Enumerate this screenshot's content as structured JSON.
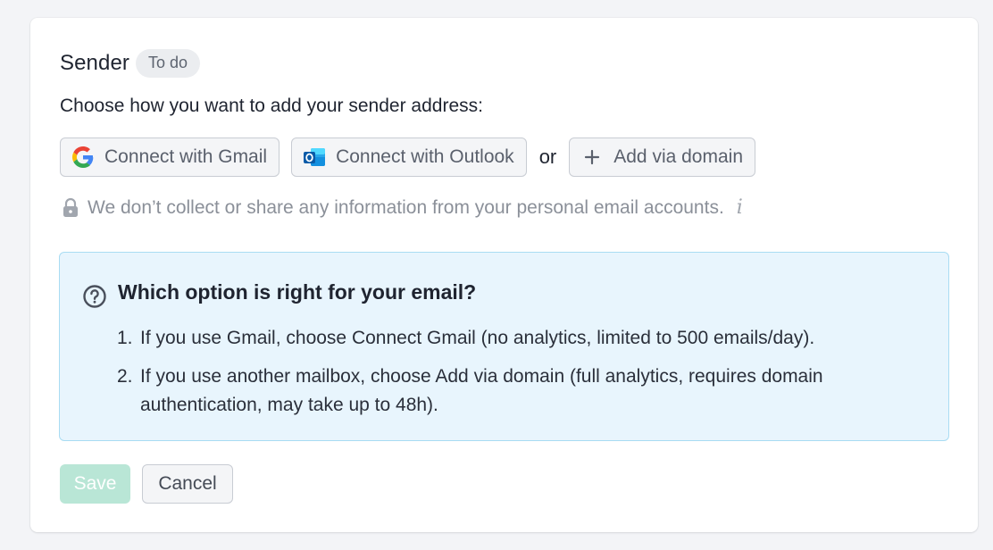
{
  "sender": {
    "title": "Sender",
    "status_badge": "To do",
    "prompt": "Choose how you want to add your sender address:"
  },
  "options": {
    "gmail_label": "Connect with Gmail",
    "outlook_label": "Connect with Outlook",
    "separator": "or",
    "domain_label": "Add via domain",
    "icons": {
      "gmail": "google-g-icon",
      "outlook": "outlook-icon",
      "domain": "plus-icon"
    }
  },
  "privacy": {
    "text": "We don’t collect or share any information from your personal email accounts.",
    "icon": "lock-icon",
    "info_glyph": "i"
  },
  "help": {
    "heading": "Which option is right for your email?",
    "icon": "question-circle-icon",
    "items": [
      {
        "num": "1.",
        "text": "If you use Gmail, choose Connect Gmail (no analytics, limited to 500 emails/day)."
      },
      {
        "num": "2.",
        "text": "If you use another mailbox, choose Add via domain (full analytics, requires domain authentication, may take up to 48h)."
      }
    ]
  },
  "actions": {
    "save_label": "Save",
    "cancel_label": "Cancel",
    "save_disabled": true
  },
  "colors": {
    "page_bg": "#f3f4f7",
    "info_bg": "#e8f5fd",
    "info_border": "#a9dcf3",
    "save_disabled_bg": "#b9e6d6",
    "badge_bg": "#ebedf0",
    "muted_text": "#8b9099"
  }
}
